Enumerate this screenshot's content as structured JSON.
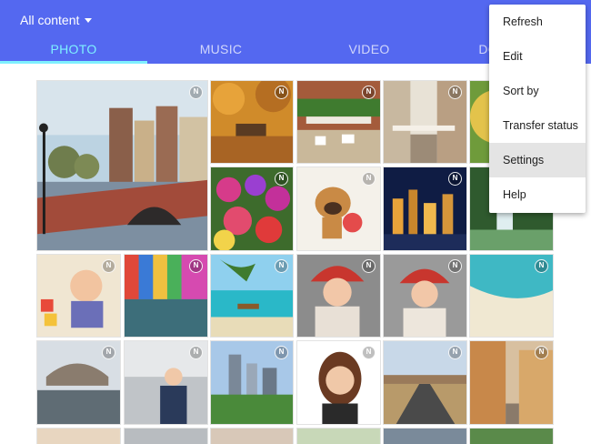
{
  "header": {
    "filter_label": "All content",
    "bg_color": "#5468f0"
  },
  "tabs": [
    {
      "label": "PHOTO",
      "active": true
    },
    {
      "label": "MUSIC",
      "active": false
    },
    {
      "label": "VIDEO",
      "active": false
    },
    {
      "label": "DOCUMENT",
      "active": false
    }
  ],
  "menu": {
    "items": [
      {
        "label": "Refresh"
      },
      {
        "label": "Edit"
      },
      {
        "label": "Sort by"
      },
      {
        "label": "Transfer status"
      },
      {
        "label": "Settings",
        "highlighted": true
      },
      {
        "label": "Help"
      }
    ]
  },
  "photos": {
    "badge": "N"
  }
}
